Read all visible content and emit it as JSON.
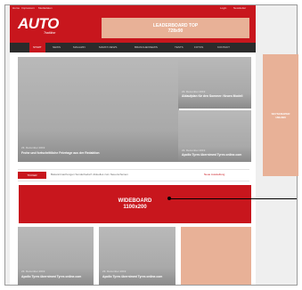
{
  "topbar": {
    "left": [
      "Home",
      "Impressum",
      "Mediadaten"
    ],
    "right": [
      "Login",
      "Newsletter"
    ]
  },
  "header": {
    "logo": "AUTO",
    "logo_sub": "Tradition",
    "leaderboard_line1": "LEADERBOARD TOP",
    "leaderboard_line2": "728x90"
  },
  "nav": {
    "items": [
      "START",
      "NEWS",
      "MAGAZIN",
      "MARKT-NEWS",
      "BRANCHENNEWS",
      "TESTS",
      "FOTOS",
      "KONTAKT"
    ]
  },
  "hero": {
    "main": {
      "date": "23. Dezember 2019",
      "title": "Frohe und fortschrittliche Feiertage aus der Redaktion"
    },
    "side": [
      {
        "date": "23. Dezember 2019",
        "title": "Ablaufplan für den Sommer: Neues Modell"
      },
      {
        "date": "23. Dezember 2019",
        "title": "Apollo Tyres übernimmt Tyres online.com"
      }
    ]
  },
  "ticker": {
    "badge": "TICKER",
    "items": [
      "Bekanntmachungen Sonderbedarf: Aktuelles zum Neuerscheinen",
      "Neue Ausstellung"
    ]
  },
  "wideboard": {
    "line1": "WIDEBOARD",
    "line2": "1100x200"
  },
  "skyscraper": {
    "line1": "SKYSCRAPER",
    "line2": "160x600"
  },
  "cards": [
    {
      "date": "23. Dezember 2019",
      "title": "Apollo Tyres übernimmt Tyres online.com"
    },
    {
      "date": "23. Dezember 2019",
      "title": "Apollo Tyres übernimmt Tyres online.com"
    }
  ],
  "colors": {
    "brand_red": "#c8161d",
    "ad_placeholder": "#e8b197",
    "nav_dark": "#2b2b2b"
  }
}
